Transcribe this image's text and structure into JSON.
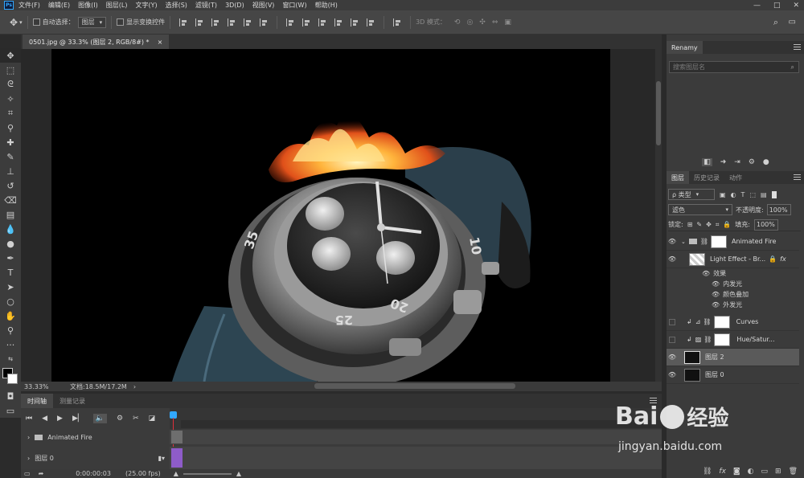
{
  "app": {
    "logo": "Ps",
    "menu": [
      "文件(F)",
      "编辑(E)",
      "图像(I)",
      "图层(L)",
      "文字(Y)",
      "选择(S)",
      "滤镜(T)",
      "3D(D)",
      "视图(V)",
      "窗口(W)",
      "帮助(H)"
    ],
    "window_controls": {
      "minimize": "—",
      "maximize": "□",
      "close": "✕"
    }
  },
  "options_bar": {
    "auto_select_label": "自动选择：",
    "auto_select_target": "图层",
    "show_transform_label": "显示变换控件",
    "mode_3d_label": "3D 模式："
  },
  "document": {
    "tab_title": "0501.jpg @ 33.3% (图层 2, RGB/8#) *",
    "tab_close": "×",
    "zoom": "33.33%",
    "doc_size": "文档:18.5M/17.2M"
  },
  "timeline": {
    "tabs": [
      "时间轴",
      "测量记录"
    ],
    "tracks": [
      {
        "label": "Animated Fire"
      },
      {
        "label": "图层 0"
      }
    ],
    "timecode": "0:00:00:03",
    "fps": "(25.00 fps)"
  },
  "renamy": {
    "tab": "Renamy",
    "search_placeholder": "搜索图层名",
    "search_icon": "search-icon",
    "toolbar_icons": [
      "panel-icon",
      "arrow-icon",
      "forward-icon",
      "settings-icon",
      "help-icon"
    ]
  },
  "layers_panel": {
    "tabs": [
      "图层",
      "历史记录",
      "动作"
    ],
    "filter_kind": "ρ 类型",
    "blend_mode": "滤色",
    "opacity_label": "不透明度:",
    "opacity_value": "100%",
    "lock_label": "锁定:",
    "fill_label": "填充:",
    "fill_value": "100%",
    "layers": [
      {
        "name": "Animated Fire",
        "type": "group",
        "visible": true
      },
      {
        "name": "Light Effect - Br...",
        "type": "layer",
        "visible": true
      },
      {
        "name": "效果",
        "type": "effects",
        "visible": true
      },
      {
        "name": "内发光",
        "type": "effect",
        "visible": true
      },
      {
        "name": "颜色叠加",
        "type": "effect",
        "visible": true
      },
      {
        "name": "外发光",
        "type": "effect",
        "visible": true
      },
      {
        "name": "Curves",
        "type": "adjustment",
        "visible": false
      },
      {
        "name": "Hue/Satur...",
        "type": "adjustment",
        "visible": false
      },
      {
        "name": "图层 2",
        "type": "layer",
        "visible": true,
        "selected": true
      },
      {
        "name": "图层 0",
        "type": "layer",
        "visible": true
      }
    ],
    "footer_icons": [
      "link-icon",
      "fx-icon",
      "mask-icon",
      "adjustment-icon",
      "folder-icon",
      "new-layer-icon",
      "trash-icon"
    ]
  },
  "watermark": {
    "brand_a": "Bai",
    "brand_b": "经验",
    "url": "jingyan.baidu.com"
  },
  "colors": {
    "accent": "#31a8ff",
    "panel": "#3b3b3b",
    "selected_layer": "#5a5a5a",
    "timeline_clip": "#8e5cc9"
  }
}
